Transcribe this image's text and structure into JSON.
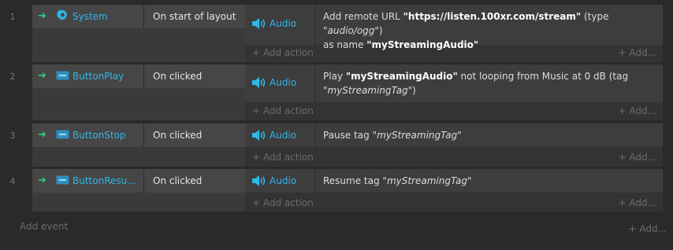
{
  "events": [
    {
      "number": "1",
      "object_name": "System",
      "object_icon": "gear-icon",
      "trigger": "On start of layout",
      "action_object": "Audio",
      "action": {
        "t1": "Add remote URL ",
        "url": "\"https://listen.100xr.com/stream\"",
        "t2": " (type ",
        "type": "\"audio/ogg\"",
        "t3": ")",
        "t4": "as name ",
        "name": "\"myStreamingAudio\""
      },
      "add_action": "+ Add action",
      "add_more": "+ Add..."
    },
    {
      "number": "2",
      "object_name": "ButtonPlay",
      "object_icon": "button-icon",
      "trigger": "On clicked",
      "action_object": "Audio",
      "action": {
        "t1": "Play ",
        "name": "\"myStreamingAudio\"",
        "t2": " not looping from Music at 0 dB (tag",
        "tag": "\"myStreamingTag\"",
        "t3": ")"
      },
      "add_action": "+ Add action",
      "add_more": "+ Add..."
    },
    {
      "number": "3",
      "object_name": "ButtonStop",
      "object_icon": "button-icon",
      "trigger": "On clicked",
      "action_object": "Audio",
      "action": {
        "t1": "Pause tag ",
        "tag": "\"myStreamingTag\""
      },
      "add_action": "+ Add action",
      "add_more": "+ Add..."
    },
    {
      "number": "4",
      "object_name": "ButtonResu...",
      "object_icon": "button-icon",
      "trigger": "On clicked",
      "action_object": "Audio",
      "action": {
        "t1": "Resume tag ",
        "tag": "\"myStreamingTag\""
      },
      "add_action": "+ Add action",
      "add_more": "+ Add..."
    }
  ],
  "footer": {
    "add_event": "Add event",
    "add_more": "+ Add..."
  },
  "colors": {
    "background": "#2a2a2a",
    "object_name": "#2fb7ea",
    "trigger_arrow": "#27d07d",
    "muted": "#6c6c6c"
  }
}
